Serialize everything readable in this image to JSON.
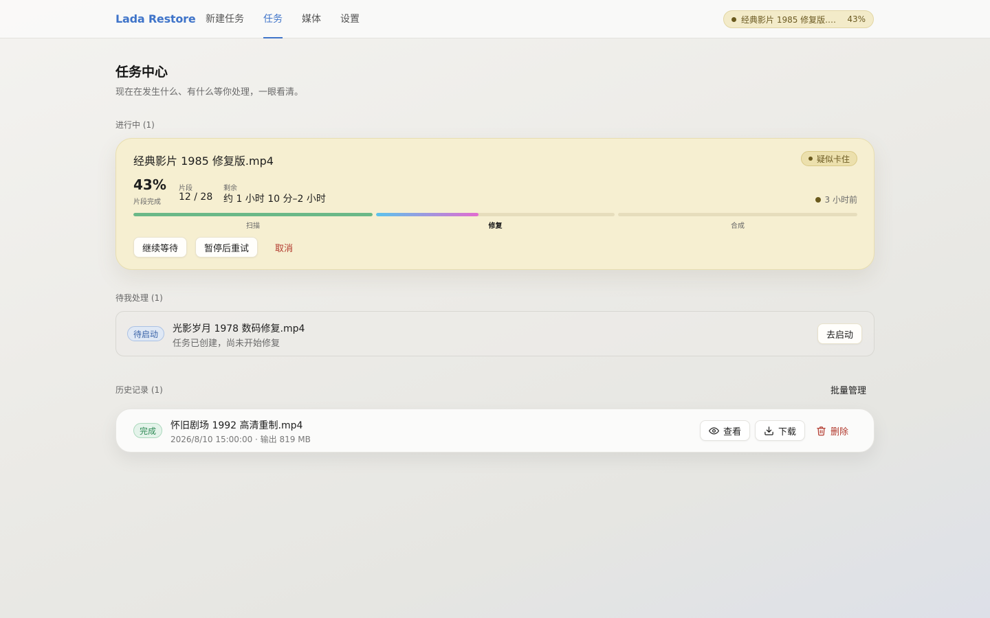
{
  "app": {
    "brand": "Lada Restore"
  },
  "nav": {
    "items": [
      {
        "label": "新建任务",
        "active": false
      },
      {
        "label": "任务",
        "active": true
      },
      {
        "label": "媒体",
        "active": false
      },
      {
        "label": "设置",
        "active": false
      }
    ]
  },
  "status_pill": {
    "name": "经典影片 1985 修复版.m...",
    "percent": "43%"
  },
  "page": {
    "title": "任务中心",
    "subtitle": "现在在发生什么、有什么等你处理，一眼看清。"
  },
  "running": {
    "section_label": "进行中 (1)",
    "title": "经典影片 1985 修复版.mp4",
    "badge": "疑似卡住",
    "percent": "43%",
    "percent_caption": "片段完成",
    "segments_caption": "片段",
    "segments_value": "12 / 28",
    "remaining_caption": "剩余",
    "remaining_value": "约 1 小时 10 分–2 小时",
    "time_ago": "3 小时前",
    "stages": [
      {
        "label": "扫描",
        "progress": 1.0,
        "current": false
      },
      {
        "label": "修复",
        "progress": 0.43,
        "current": true
      },
      {
        "label": "合成",
        "progress": 0.0,
        "current": false
      }
    ],
    "actions": {
      "continue": "继续等待",
      "pause_retry": "暂停后重试",
      "cancel": "取消"
    }
  },
  "pending": {
    "section_label": "待我处理 (1)",
    "tag": "待启动",
    "title": "光影岁月 1978 数码修复.mp4",
    "subtitle": "任务已创建，尚未开始修复",
    "action": "去启动"
  },
  "history": {
    "section_label": "历史记录 (1)",
    "batch_label": "批量管理",
    "items": [
      {
        "tag": "完成",
        "title": "怀旧剧场 1992 高清重制.mp4",
        "meta": "2026/8/10 15:00:00 · 输出 819 MB",
        "view": "查看",
        "download": "下载",
        "delete": "删除"
      }
    ]
  },
  "colors": {
    "accent": "#3f74c9",
    "stuck": "#6b5a22",
    "scan_bar": "#6ab887",
    "repair_bar_start": "#5bc3ec",
    "repair_bar_end": "#e26bd0",
    "danger": "#b23a2e",
    "done": "#2e8a55"
  }
}
